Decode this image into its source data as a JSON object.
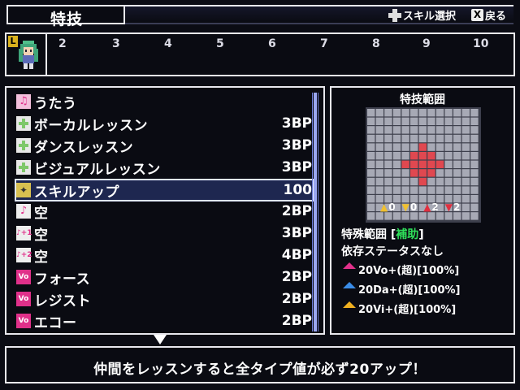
{
  "header": {
    "title": "特技",
    "hint_select": "スキル選択",
    "hint_back": "戻る",
    "hint_back_key": "X"
  },
  "party": {
    "level_badge": "L",
    "slot_numbers": [
      "2",
      "3",
      "4",
      "5",
      "6",
      "7",
      "8",
      "9",
      "10"
    ]
  },
  "skills": [
    {
      "name": "うたう",
      "cost": "",
      "icon": "music-pink",
      "icon_color": "#e0308a"
    },
    {
      "name": "ボーカルレッスン",
      "cost": "3BP",
      "icon": "plus-green",
      "icon_color": "#7ec86a"
    },
    {
      "name": "ダンスレッスン",
      "cost": "3BP",
      "icon": "plus-green",
      "icon_color": "#7ec86a"
    },
    {
      "name": "ビジュアルレッスン",
      "cost": "3BP",
      "icon": "plus-green",
      "icon_color": "#7ec86a"
    },
    {
      "name": "スキルアップ",
      "cost": "100",
      "icon": "sparkle-yellow",
      "icon_color": "#d8c050",
      "selected": true
    },
    {
      "name": "空",
      "cost": "2BP",
      "icon": "note-pink",
      "icon_color": "#e0308a"
    },
    {
      "name": "空",
      "cost": "3BP",
      "icon": "note-plus-1",
      "icon_color": "#e0308a"
    },
    {
      "name": "空",
      "cost": "4BP",
      "icon": "note-plus-2",
      "icon_color": "#e0308a"
    },
    {
      "name": "フォース",
      "cost": "2BP",
      "icon": "vo-badge",
      "icon_color": "#e0308a"
    },
    {
      "name": "レジスト",
      "cost": "2BP",
      "icon": "vo-badge",
      "icon_color": "#e0308a"
    },
    {
      "name": "エコー",
      "cost": "2BP",
      "icon": "vo-badge",
      "icon_color": "#e0308a"
    }
  ],
  "range": {
    "title": "特技範囲",
    "grid_size": 13,
    "highlight_cells": [
      [
        6,
        4
      ],
      [
        5,
        5
      ],
      [
        6,
        5
      ],
      [
        7,
        5
      ],
      [
        4,
        6
      ],
      [
        5,
        6
      ],
      [
        6,
        6
      ],
      [
        7,
        6
      ],
      [
        8,
        6
      ],
      [
        5,
        7
      ],
      [
        6,
        7
      ],
      [
        7,
        7
      ],
      [
        6,
        8
      ]
    ],
    "stat_arrows": [
      {
        "dir": "up",
        "value": "0",
        "color": "#f0c030"
      },
      {
        "dir": "down",
        "value": "0",
        "color": "#f0c030"
      },
      {
        "dir": "up",
        "value": "2",
        "color": "#e03040"
      },
      {
        "dir": "down",
        "value": "2",
        "color": "#e03040"
      }
    ],
    "special_label": "特殊範囲 [",
    "special_value": "補助",
    "special_close": "]",
    "dependency": "依存ステータスなし",
    "effects": [
      {
        "text": "20Vo+(超)[100%]",
        "color": "#e0308a"
      },
      {
        "text": "20Da+(超)[100%]",
        "color": "#3a8ce8"
      },
      {
        "text": "20Vi+(超)[100%]",
        "color": "#f0b020"
      }
    ]
  },
  "description": "仲間をレッスンすると全タイプ値が必ず20アップ！"
}
